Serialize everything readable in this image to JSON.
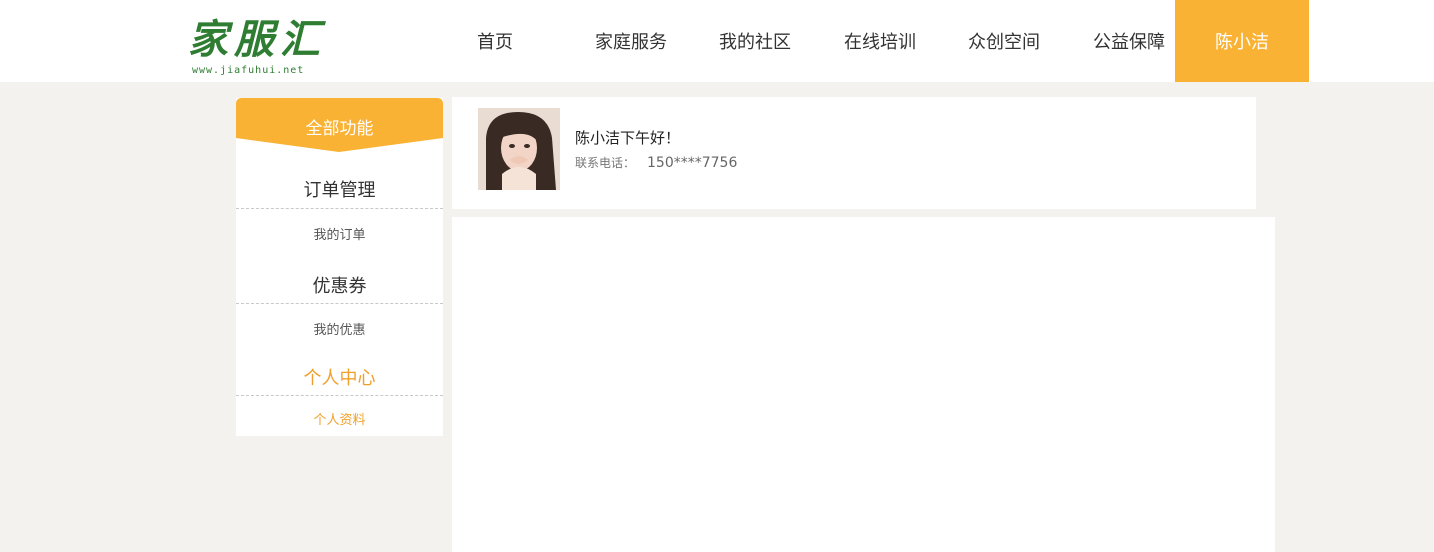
{
  "header": {
    "logo_text": "家服汇",
    "logo_url": "www.jiafuhui.net",
    "nav": [
      {
        "label": "首页"
      },
      {
        "label": "家庭服务"
      },
      {
        "label": "我的社区"
      },
      {
        "label": "在线培训"
      },
      {
        "label": "众创空间"
      },
      {
        "label": "公益保障"
      },
      {
        "label": "陈小洁"
      }
    ],
    "accent_color": "#f9b233"
  },
  "sidebar": {
    "title": "全部功能",
    "groups": [
      {
        "title": "订单管理",
        "links": [
          "我的订单"
        ]
      },
      {
        "title": "优惠券",
        "links": [
          "我的优惠"
        ]
      },
      {
        "title": "个人中心",
        "links": [
          "个人资料"
        ]
      }
    ]
  },
  "user": {
    "greeting": "陈小洁下午好！",
    "phone_label": "联系电话：",
    "phone": "150****7756"
  }
}
